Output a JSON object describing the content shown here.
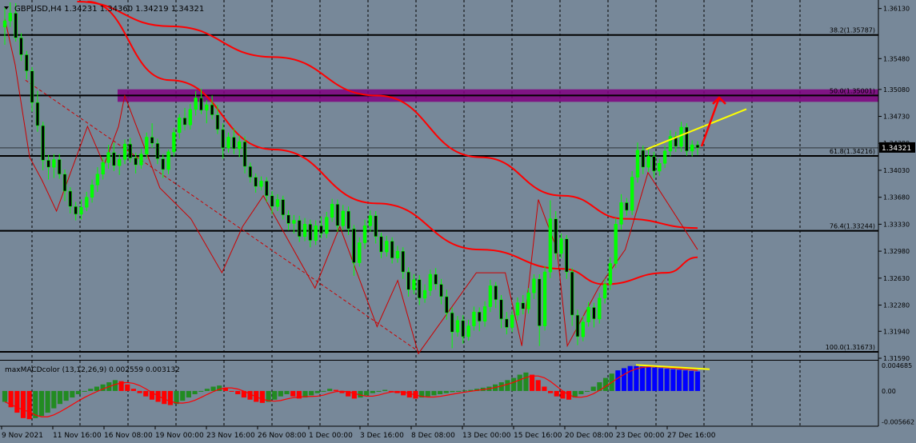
{
  "window": {
    "symbol_header": "GBPUSD,H4  1.34231 1.34360 1.34219 1.34321",
    "indicator_header": "maxMACDcolor (13,12,26,9) 0.002559 0.003132"
  },
  "colors": {
    "background": "#778899",
    "bull_candle": "#00ff00",
    "bear_candle": "#000000",
    "moving_average": "#ff0000",
    "zigzag": "#cc0000",
    "fib_line": "#000000",
    "resistance_zone": "#800080",
    "trend_line": "#ffff00",
    "arrow": "#ff0000",
    "macd_up": "#228b22",
    "macd_down": "#ff0000",
    "macd_blue": "#0000ff",
    "macd_signal": "#ff0000",
    "current_price_label": "#000000"
  },
  "chart_data": [
    {
      "type": "candlestick",
      "symbol": "GBPUSD",
      "timeframe": "H4",
      "ylim": [
        1.3159,
        1.3622
      ],
      "y_ticks": [
        "1.36130",
        "1.35480",
        "1.35080",
        "1.34730",
        "1.34380",
        "1.34030",
        "1.33680",
        "1.33330",
        "1.32980",
        "1.32630",
        "1.32280",
        "1.31940",
        "1.31590"
      ],
      "x_ticks": [
        "9 Nov 2021",
        "11 Nov 16:00",
        "16 Nov 08:00",
        "19 Nov 00:00",
        "23 Nov 16:00",
        "26 Nov 08:00",
        "1 Dec 00:00",
        "3 Dec 16:00",
        "8 Dec 08:00",
        "13 Dec 00:00",
        "15 Dec 16:00",
        "20 Dec 08:00",
        "23 Dec 00:00",
        "27 Dec 16:00"
      ],
      "current_price": "1.34321",
      "fib_levels": [
        {
          "label": "38.2(1.35787)",
          "price": 1.35787
        },
        {
          "label": "50.0(1.35001)",
          "price": 1.35001
        },
        {
          "label": "61.8(1.34216)",
          "price": 1.34216
        },
        {
          "label": "76.4(1.33244)",
          "price": 1.33244
        },
        {
          "label": "100.0(1.31673)",
          "price": 1.31673
        }
      ],
      "resistance_zone": {
        "price_low": 1.3495,
        "price_high": 1.3505
      },
      "zigzag_points": [
        [
          0,
          1.36
        ],
        [
          5,
          1.354
        ],
        [
          12,
          1.342
        ],
        [
          18,
          1.339
        ],
        [
          25,
          1.335
        ],
        [
          40,
          1.346
        ],
        [
          48,
          1.341
        ],
        [
          55,
          1.346
        ],
        [
          58,
          1.35
        ],
        [
          75,
          1.338
        ],
        [
          90,
          1.334
        ],
        [
          105,
          1.327
        ],
        [
          115,
          1.333
        ],
        [
          125,
          1.337
        ],
        [
          150,
          1.325
        ],
        [
          162,
          1.333
        ],
        [
          180,
          1.32
        ],
        [
          190,
          1.326
        ],
        [
          200,
          1.3165
        ],
        [
          228,
          1.327
        ],
        [
          242,
          1.327
        ],
        [
          250,
          1.3175
        ],
        [
          258,
          1.3365
        ],
        [
          267,
          1.33
        ],
        [
          272,
          1.3175
        ],
        [
          287,
          1.325
        ],
        [
          300,
          1.33
        ],
        [
          311,
          1.34
        ],
        [
          335,
          1.33
        ]
      ],
      "dashed_trend": [
        [
          10,
          1.352
        ],
        [
          200,
          1.3168
        ]
      ],
      "yellow_trend": [
        [
          310,
          1.343
        ],
        [
          347,
          1.347
        ]
      ],
      "moving_averages": [
        {
          "name": "slow",
          "points": [
            [
              35,
              1.3622
            ],
            [
              80,
              1.359
            ],
            [
              130,
              1.355
            ],
            [
              180,
              1.35
            ],
            [
              230,
              1.342
            ],
            [
              270,
              1.337
            ],
            [
              300,
              1.334
            ],
            [
              335,
              1.3328
            ]
          ]
        },
        {
          "name": "fast",
          "points": [
            [
              40,
              1.3622
            ],
            [
              80,
              1.352
            ],
            [
              130,
              1.343
            ],
            [
              180,
              1.336
            ],
            [
              230,
              1.33
            ],
            [
              270,
              1.3275
            ],
            [
              290,
              1.3255
            ],
            [
              320,
              1.327
            ],
            [
              335,
              1.329
            ]
          ]
        }
      ],
      "candles": [
        [
          1.3589,
          1.3614,
          1.3566,
          1.3597
        ],
        [
          1.3597,
          1.3621,
          1.3589,
          1.3607
        ],
        [
          1.3607,
          1.362,
          1.357,
          1.3575
        ],
        [
          1.3575,
          1.3581,
          1.3545,
          1.3553
        ],
        [
          1.3553,
          1.3558,
          1.3521,
          1.3532
        ],
        [
          1.3532,
          1.3537,
          1.3479,
          1.3491
        ],
        [
          1.3491,
          1.3506,
          1.3453,
          1.3461
        ],
        [
          1.3461,
          1.3466,
          1.3403,
          1.3416
        ],
        [
          1.3416,
          1.3423,
          1.3391,
          1.3407
        ],
        [
          1.3407,
          1.3424,
          1.3393,
          1.3417
        ],
        [
          1.3417,
          1.3424,
          1.3392,
          1.3398
        ],
        [
          1.3398,
          1.3404,
          1.3363,
          1.3376
        ],
        [
          1.3376,
          1.3381,
          1.3347,
          1.3356
        ],
        [
          1.3356,
          1.3362,
          1.3338,
          1.3346
        ],
        [
          1.3346,
          1.3365,
          1.3339,
          1.3355
        ],
        [
          1.3355,
          1.3375,
          1.335,
          1.3368
        ],
        [
          1.3368,
          1.3391,
          1.3361,
          1.3384
        ],
        [
          1.3384,
          1.3407,
          1.3375,
          1.3398
        ],
        [
          1.3398,
          1.342,
          1.3391,
          1.3413
        ],
        [
          1.3413,
          1.3436,
          1.3405,
          1.3426
        ],
        [
          1.3426,
          1.3439,
          1.3402,
          1.3409
        ],
        [
          1.3409,
          1.3424,
          1.3397,
          1.3417
        ],
        [
          1.3417,
          1.3443,
          1.3411,
          1.3437
        ],
        [
          1.3437,
          1.3445,
          1.3413,
          1.3419
        ],
        [
          1.3419,
          1.3426,
          1.3399,
          1.341
        ],
        [
          1.341,
          1.3431,
          1.3405,
          1.3424
        ],
        [
          1.3424,
          1.3452,
          1.3418,
          1.3446
        ],
        [
          1.3446,
          1.3464,
          1.3432,
          1.3438
        ],
        [
          1.3438,
          1.3444,
          1.3411,
          1.3418
        ],
        [
          1.3418,
          1.3424,
          1.3393,
          1.3404
        ],
        [
          1.3404,
          1.343,
          1.3398,
          1.3427
        ],
        [
          1.3427,
          1.3458,
          1.3421,
          1.3452
        ],
        [
          1.3452,
          1.3476,
          1.3444,
          1.3471
        ],
        [
          1.3471,
          1.3484,
          1.3455,
          1.3462
        ],
        [
          1.3462,
          1.3489,
          1.3456,
          1.3482
        ],
        [
          1.3482,
          1.3506,
          1.3474,
          1.3497
        ],
        [
          1.3497,
          1.3509,
          1.3476,
          1.3481
        ],
        [
          1.3481,
          1.3494,
          1.3464,
          1.3488
        ],
        [
          1.3488,
          1.35,
          1.3469,
          1.3475
        ],
        [
          1.3475,
          1.3488,
          1.345,
          1.3456
        ],
        [
          1.3456,
          1.3464,
          1.3418,
          1.3432
        ],
        [
          1.3432,
          1.3452,
          1.3426,
          1.3446
        ],
        [
          1.3446,
          1.3458,
          1.3424,
          1.3431
        ],
        [
          1.3431,
          1.3448,
          1.342,
          1.344
        ],
        [
          1.344,
          1.3447,
          1.3399,
          1.3408
        ],
        [
          1.3408,
          1.3413,
          1.3387,
          1.3394
        ],
        [
          1.3394,
          1.3399,
          1.3374,
          1.3382
        ],
        [
          1.3382,
          1.3395,
          1.3377,
          1.3389
        ],
        [
          1.3389,
          1.3394,
          1.3362,
          1.337
        ],
        [
          1.337,
          1.3376,
          1.3346,
          1.3356
        ],
        [
          1.3356,
          1.3372,
          1.335,
          1.3365
        ],
        [
          1.3365,
          1.337,
          1.3339,
          1.3345
        ],
        [
          1.3345,
          1.3351,
          1.3325,
          1.3334
        ],
        [
          1.3334,
          1.3345,
          1.3321,
          1.3338
        ],
        [
          1.3338,
          1.3344,
          1.331,
          1.3317
        ],
        [
          1.3317,
          1.3341,
          1.3311,
          1.3333
        ],
        [
          1.3333,
          1.3339,
          1.3303,
          1.3312
        ],
        [
          1.3312,
          1.3338,
          1.3306,
          1.3331
        ],
        [
          1.3331,
          1.3343,
          1.3315,
          1.3321
        ],
        [
          1.3321,
          1.3349,
          1.3315,
          1.3342
        ],
        [
          1.3342,
          1.3366,
          1.3336,
          1.3359
        ],
        [
          1.3359,
          1.3365,
          1.3323,
          1.3331
        ],
        [
          1.3331,
          1.3358,
          1.3325,
          1.335
        ],
        [
          1.335,
          1.3356,
          1.3319,
          1.3327
        ],
        [
          1.3327,
          1.3332,
          1.3266,
          1.3283
        ],
        [
          1.3283,
          1.3316,
          1.3278,
          1.3309
        ],
        [
          1.3309,
          1.3339,
          1.3301,
          1.3331
        ],
        [
          1.3331,
          1.3351,
          1.3323,
          1.3344
        ],
        [
          1.3344,
          1.335,
          1.3308,
          1.3317
        ],
        [
          1.3317,
          1.3322,
          1.3289,
          1.3297
        ],
        [
          1.3297,
          1.3318,
          1.3291,
          1.3311
        ],
        [
          1.3311,
          1.3316,
          1.3282,
          1.3289
        ],
        [
          1.3289,
          1.3305,
          1.3283,
          1.3298
        ],
        [
          1.3298,
          1.3303,
          1.3262,
          1.3271
        ],
        [
          1.3271,
          1.3277,
          1.3239,
          1.3248
        ],
        [
          1.3248,
          1.3268,
          1.3242,
          1.3261
        ],
        [
          1.3261,
          1.3267,
          1.3228,
          1.3237
        ],
        [
          1.3237,
          1.3255,
          1.3231,
          1.3247
        ],
        [
          1.3247,
          1.3274,
          1.324,
          1.3268
        ],
        [
          1.3268,
          1.3276,
          1.3248,
          1.3255
        ],
        [
          1.3255,
          1.3262,
          1.3229,
          1.3239
        ],
        [
          1.3239,
          1.3248,
          1.3209,
          1.3218
        ],
        [
          1.3218,
          1.3225,
          1.3172,
          1.3193
        ],
        [
          1.3193,
          1.3214,
          1.3187,
          1.3208
        ],
        [
          1.3208,
          1.3215,
          1.3178,
          1.3187
        ],
        [
          1.3187,
          1.3209,
          1.3182,
          1.3201
        ],
        [
          1.3201,
          1.3226,
          1.3195,
          1.3219
        ],
        [
          1.3219,
          1.3225,
          1.3194,
          1.3207
        ],
        [
          1.3207,
          1.3233,
          1.32,
          1.3226
        ],
        [
          1.3226,
          1.3261,
          1.3219,
          1.3253
        ],
        [
          1.3253,
          1.3258,
          1.3224,
          1.3235
        ],
        [
          1.3235,
          1.3241,
          1.3198,
          1.321
        ],
        [
          1.321,
          1.3219,
          1.319,
          1.3199
        ],
        [
          1.3199,
          1.3221,
          1.3193,
          1.3215
        ],
        [
          1.3215,
          1.3238,
          1.3208,
          1.3231
        ],
        [
          1.3231,
          1.3241,
          1.3216,
          1.3223
        ],
        [
          1.3223,
          1.325,
          1.3217,
          1.3244
        ],
        [
          1.3244,
          1.3268,
          1.3236,
          1.3262
        ],
        [
          1.3262,
          1.3268,
          1.3175,
          1.3201
        ],
        [
          1.3201,
          1.3279,
          1.3195,
          1.3271
        ],
        [
          1.3271,
          1.3364,
          1.3263,
          1.334
        ],
        [
          1.334,
          1.335,
          1.3287,
          1.3295
        ],
        [
          1.3295,
          1.3321,
          1.3289,
          1.3314
        ],
        [
          1.3314,
          1.3319,
          1.3262,
          1.3271
        ],
        [
          1.3271,
          1.3276,
          1.3201,
          1.3215
        ],
        [
          1.3215,
          1.3222,
          1.3176,
          1.3187
        ],
        [
          1.3187,
          1.3214,
          1.3181,
          1.3206
        ],
        [
          1.3206,
          1.3232,
          1.32,
          1.3225
        ],
        [
          1.3225,
          1.3231,
          1.3199,
          1.321
        ],
        [
          1.321,
          1.3244,
          1.3204,
          1.3237
        ],
        [
          1.3237,
          1.3262,
          1.323,
          1.3255
        ],
        [
          1.3255,
          1.329,
          1.3248,
          1.3282
        ],
        [
          1.3282,
          1.3341,
          1.3276,
          1.3333
        ],
        [
          1.3333,
          1.3372,
          1.3326,
          1.3361
        ],
        [
          1.3361,
          1.3367,
          1.3344,
          1.3351
        ],
        [
          1.3351,
          1.3402,
          1.3345,
          1.3394
        ],
        [
          1.3394,
          1.3439,
          1.3387,
          1.3429
        ],
        [
          1.3429,
          1.3435,
          1.3398,
          1.3407
        ],
        [
          1.3407,
          1.3431,
          1.3401,
          1.3421
        ],
        [
          1.3421,
          1.3427,
          1.3393,
          1.3402
        ],
        [
          1.3402,
          1.3418,
          1.3396,
          1.3412
        ],
        [
          1.3412,
          1.3435,
          1.3406,
          1.3428
        ],
        [
          1.3428,
          1.3455,
          1.3421,
          1.3447
        ],
        [
          1.3447,
          1.3453,
          1.3427,
          1.3434
        ],
        [
          1.3434,
          1.3466,
          1.3427,
          1.3459
        ],
        [
          1.3459,
          1.3464,
          1.3422,
          1.3428
        ],
        [
          1.3428,
          1.3442,
          1.3421,
          1.3436
        ],
        [
          1.3436,
          1.3441,
          1.3423,
          1.3432
        ]
      ]
    },
    {
      "type": "bar",
      "name": "maxMACDcolor",
      "params": "13,12,26,9",
      "ylim": [
        -0.0062,
        0.005
      ],
      "y_ticks": [
        "0.004685",
        "0.00",
        "-0.005662"
      ],
      "values": [
        -0.002,
        -0.003,
        -0.004,
        -0.005,
        -0.0052,
        -0.005,
        -0.0046,
        -0.004,
        -0.0032,
        -0.0024,
        -0.0018,
        -0.0012,
        -0.0006,
        0.0,
        0.0004,
        0.0008,
        0.0012,
        0.0016,
        0.002,
        0.0018,
        0.0012,
        0.0004,
        -0.0004,
        -0.001,
        -0.0016,
        -0.002,
        -0.0024,
        -0.0026,
        -0.0024,
        -0.0018,
        -0.0012,
        -0.0006,
        0.0,
        0.0004,
        0.0008,
        0.001,
        0.0006,
        0.0,
        -0.0006,
        -0.0012,
        -0.0016,
        -0.002,
        -0.0022,
        -0.002,
        -0.0016,
        -0.001,
        -0.0006,
        -0.001,
        -0.0014,
        -0.0012,
        -0.0008,
        -0.0004,
        0.0,
        0.0004,
        0.0002,
        -0.0004,
        -0.001,
        -0.0014,
        -0.0012,
        -0.0008,
        -0.0004,
        0.0,
        0.0002,
        0.0,
        -0.0004,
        -0.0008,
        -0.0012,
        -0.0014,
        -0.0012,
        -0.001,
        -0.0008,
        -0.0006,
        -0.0004,
        -0.0002,
        0.0,
        0.0001,
        0.0002,
        0.0004,
        0.0006,
        0.0008,
        0.0012,
        0.0016,
        0.002,
        0.0024,
        0.003,
        0.0034,
        0.003,
        0.002,
        0.0008,
        -0.0004,
        -0.001,
        -0.0014,
        -0.0016,
        -0.0012,
        -0.0006,
        0.0,
        0.0008,
        0.0016,
        0.0024,
        0.0032,
        0.0038,
        0.0042,
        0.0046,
        0.0046,
        0.0045,
        0.0044,
        0.0043,
        0.0042,
        0.0041,
        0.004,
        0.0039,
        0.0038,
        0.0037,
        0.0036
      ]
    }
  ]
}
